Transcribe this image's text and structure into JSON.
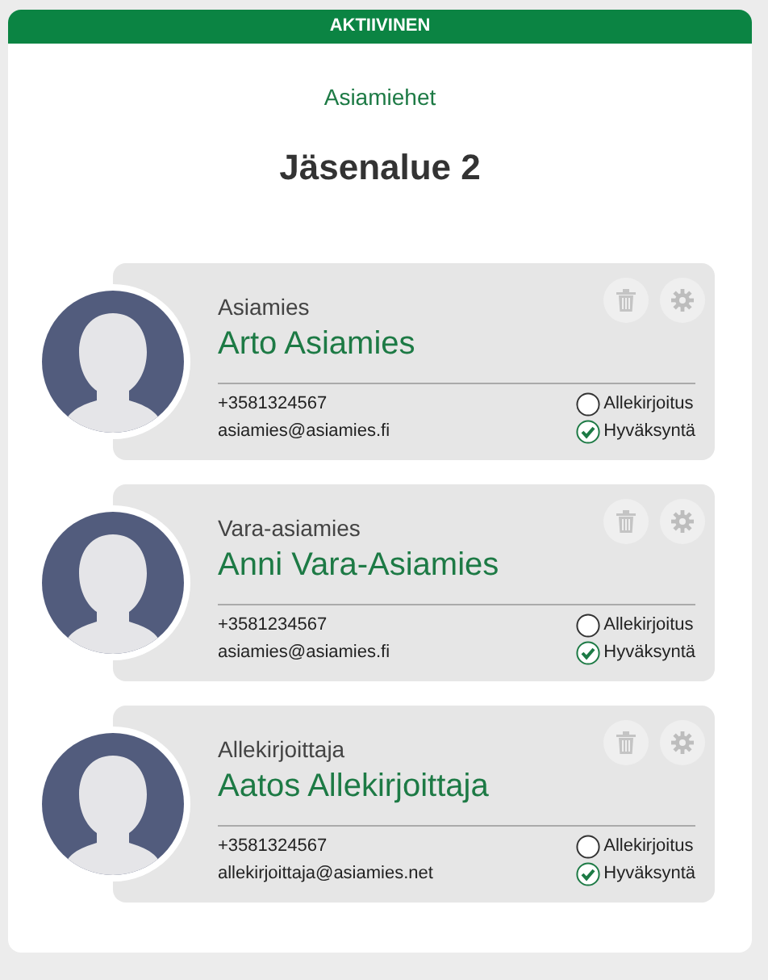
{
  "status_banner": "AKTIIVINEN",
  "section_label": "Asiamiehet",
  "title": "Jäsenalue 2",
  "contacts": [
    {
      "role": "Asiamies",
      "name": "Arto Asiamies",
      "phone": "+3581324567",
      "email": "asiamies@asiamies.fi",
      "approvals": [
        {
          "label": "Allekirjoitus",
          "checked": false
        },
        {
          "label": "Hyväksyntä",
          "checked": true
        }
      ]
    },
    {
      "role": "Vara-asiamies",
      "name": "Anni Vara-Asiamies",
      "phone": "+3581234567",
      "email": "asiamies@asiamies.fi",
      "approvals": [
        {
          "label": "Allekirjoitus",
          "checked": false
        },
        {
          "label": "Hyväksyntä",
          "checked": true
        }
      ]
    },
    {
      "role": "Allekirjoittaja",
      "name": "Aatos Allekirjoittaja",
      "phone": "+3581324567",
      "email": "allekirjoittaja@asiamies.net",
      "approvals": [
        {
          "label": "Allekirjoitus",
          "checked": false
        },
        {
          "label": "Hyväksyntä",
          "checked": true
        }
      ]
    }
  ]
}
